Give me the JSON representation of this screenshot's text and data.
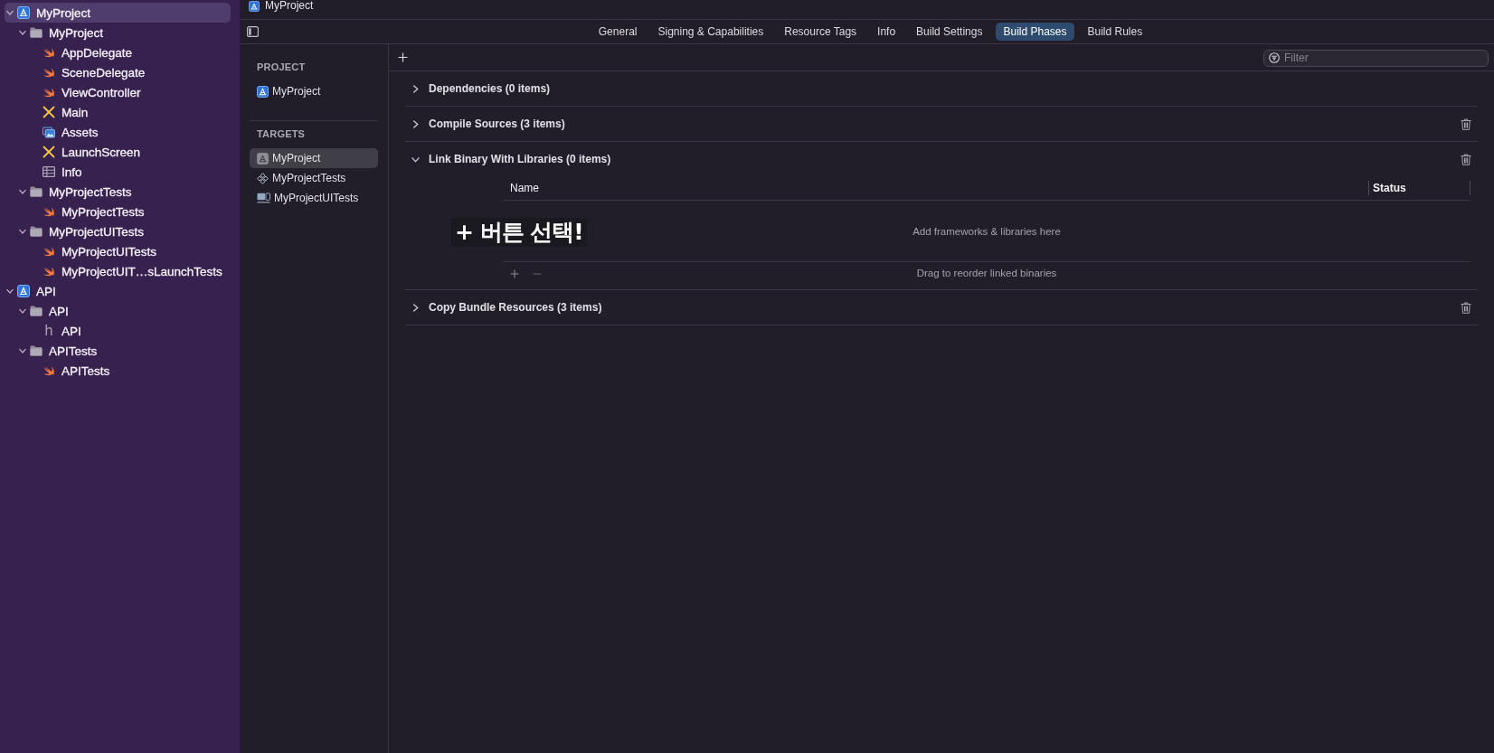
{
  "navigator": {
    "items": [
      {
        "name": "MyProject",
        "kind": "project",
        "selected": true,
        "expanded": true,
        "children": [
          {
            "name": "MyProject",
            "kind": "folder",
            "selected": false,
            "expanded": true,
            "children": [
              {
                "name": "AppDelegate",
                "kind": "swift",
                "selected": false
              },
              {
                "name": "SceneDelegate",
                "kind": "swift",
                "selected": false
              },
              {
                "name": "ViewController",
                "kind": "swift",
                "selected": false
              },
              {
                "name": "Main",
                "kind": "storyboard",
                "selected": false
              },
              {
                "name": "Assets",
                "kind": "assets",
                "selected": false
              },
              {
                "name": "LaunchScreen",
                "kind": "storyboard",
                "selected": false
              },
              {
                "name": "Info",
                "kind": "plist",
                "selected": false
              }
            ]
          },
          {
            "name": "MyProjectTests",
            "kind": "folder",
            "selected": false,
            "expanded": true,
            "children": [
              {
                "name": "MyProjectTests",
                "kind": "swift",
                "selected": false
              }
            ]
          },
          {
            "name": "MyProjectUITests",
            "kind": "folder",
            "selected": false,
            "expanded": true,
            "children": [
              {
                "name": "MyProjectUITests",
                "kind": "swift",
                "selected": false
              },
              {
                "name": "MyProjectUIT…sLaunchTests",
                "kind": "swift",
                "selected": false
              }
            ]
          }
        ]
      },
      {
        "name": "API",
        "kind": "project",
        "selected": false,
        "expanded": true,
        "children": [
          {
            "name": "API",
            "kind": "folder",
            "selected": false,
            "expanded": true,
            "children": [
              {
                "name": "API",
                "kind": "header",
                "glyph": "h",
                "selected": false
              }
            ]
          },
          {
            "name": "APITests",
            "kind": "folder",
            "selected": false,
            "expanded": true,
            "children": [
              {
                "name": "APITests",
                "kind": "swift",
                "selected": false
              }
            ]
          }
        ]
      }
    ]
  },
  "editor": {
    "title": "MyProject",
    "tabs": [
      {
        "label": "General",
        "selected": false
      },
      {
        "label": "Signing & Capabilities",
        "selected": false
      },
      {
        "label": "Resource Tags",
        "selected": false
      },
      {
        "label": "Info",
        "selected": false
      },
      {
        "label": "Build Settings",
        "selected": false
      },
      {
        "label": "Build Phases",
        "selected": true
      },
      {
        "label": "Build Rules",
        "selected": false
      }
    ]
  },
  "targets_panel": {
    "project_heading": "PROJECT",
    "project": {
      "name": "MyProject",
      "selected": false
    },
    "targets_heading": "TARGETS",
    "targets": [
      {
        "name": "MyProject",
        "kind": "app",
        "selected": true
      },
      {
        "name": "MyProjectTests",
        "kind": "unit_tests",
        "selected": false
      },
      {
        "name": "MyProjectUITests",
        "kind": "ui_tests",
        "selected": false
      }
    ]
  },
  "build_phases": {
    "filter": {
      "placeholder": "Filter"
    },
    "phases": [
      {
        "title": "Dependencies (0 items)",
        "expanded": false,
        "deletable": false
      },
      {
        "title": "Compile Sources (3 items)",
        "expanded": false,
        "deletable": true
      },
      {
        "title": "Link Binary With Libraries (0 items)",
        "expanded": true,
        "deletable": true,
        "table": {
          "columns": [
            "Name",
            "Status"
          ],
          "empty_hint": "Add frameworks & libraries here",
          "footer_hint": "Drag to reorder linked binaries"
        },
        "annotation": "+ 버튼 선택!"
      },
      {
        "title": "Copy Bundle Resources (3 items)",
        "expanded": false,
        "deletable": true
      }
    ]
  }
}
